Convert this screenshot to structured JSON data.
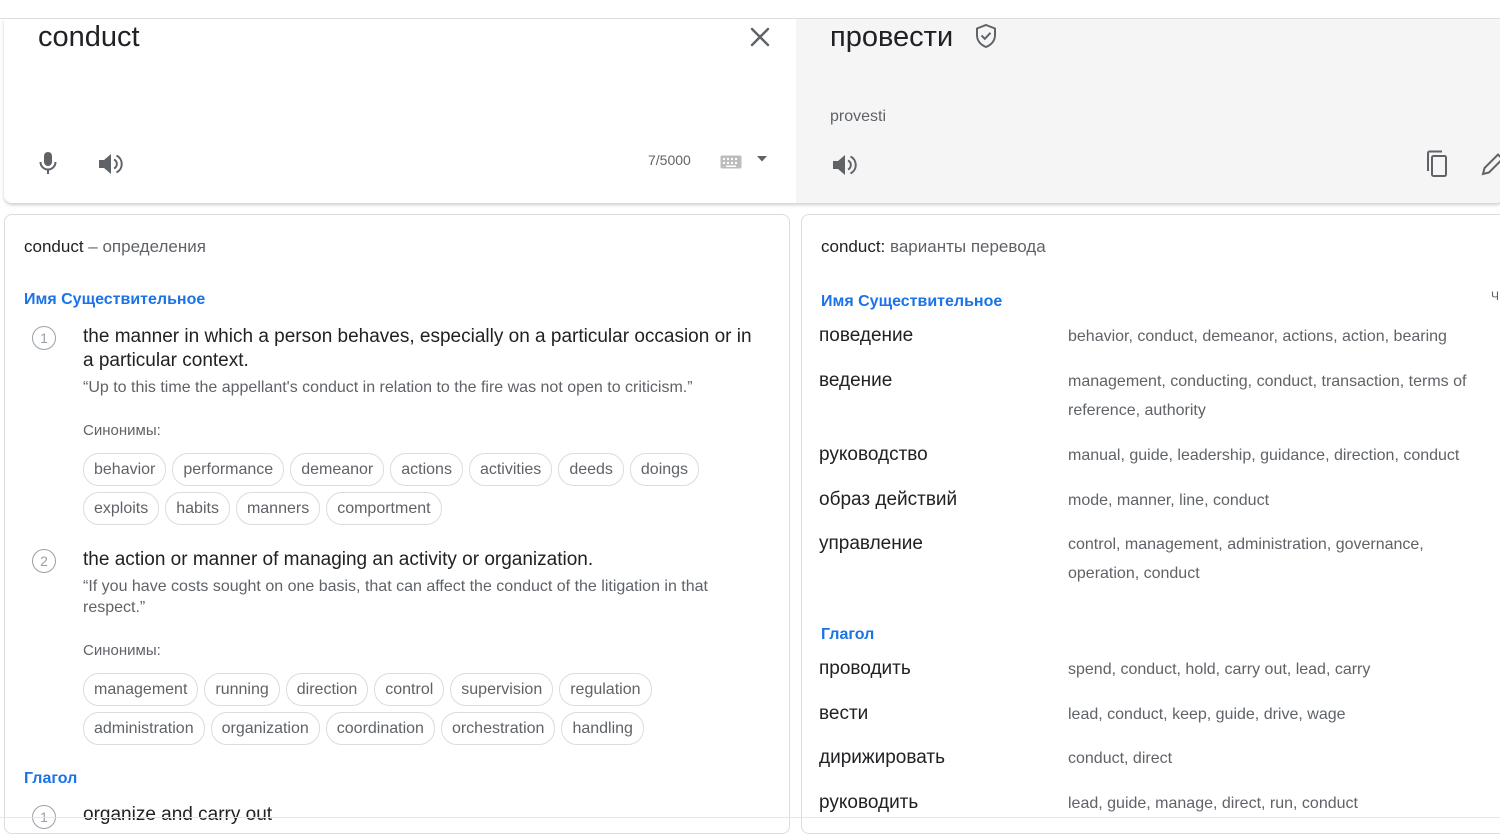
{
  "source": {
    "text": "conduct",
    "char_count": "7/5000"
  },
  "target": {
    "text": "провести",
    "transliteration": "provesti"
  },
  "definitions": {
    "word": "conduct",
    "title_suffix": " – определения",
    "noun_label": "Имя Существительное",
    "verb_label": "Глагол",
    "synonyms_label": "Синонимы:",
    "items": [
      {
        "num": "1",
        "text": "the manner in which a person behaves, especially on a particular occasion or in a particular context.",
        "example": "“Up to this time the appellant's conduct in relation to the fire was not open to criticism.”",
        "synonym_rows": [
          [
            "behavior",
            "performance",
            "demeanor",
            "actions",
            "activities",
            "deeds",
            "doings"
          ],
          [
            "exploits",
            "habits",
            "manners",
            "comportment"
          ]
        ]
      },
      {
        "num": "2",
        "text": "the action or manner of managing an activity or organization.",
        "example": "“If you have costs sought on one basis, that can affect the conduct of the litigation in that respect.”",
        "synonym_rows": [
          [
            "management",
            "running",
            "direction",
            "control",
            "supervision",
            "regulation"
          ],
          [
            "administration",
            "organization",
            "coordination",
            "orchestration",
            "handling"
          ]
        ]
      }
    ],
    "verb_item": {
      "num": "1",
      "text": "organize and carry out"
    }
  },
  "variants": {
    "word": "conduct",
    "title_suffix": " варианты перевода",
    "noun_label": "Имя Существительное",
    "verb_label": "Глагол",
    "freq_mark": "Ч",
    "nouns": [
      {
        "word": "поведение",
        "translations": "behavior, conduct, demeanor, actions, action, bearing"
      },
      {
        "word": "ведение",
        "translations": "management, conducting, conduct, transaction, terms of reference, authority"
      },
      {
        "word": "руководство",
        "translations": "manual, guide, leadership, guidance, direction, conduct"
      },
      {
        "word": "образ действий",
        "translations": "mode, manner, line, conduct"
      },
      {
        "word": "управление",
        "translations": "control, management, administration, governance, operation, conduct"
      }
    ],
    "verbs": [
      {
        "word": "проводить",
        "translations": "spend, conduct, hold, carry out, lead, carry"
      },
      {
        "word": "вести",
        "translations": "lead, conduct, keep, guide, drive, wage"
      },
      {
        "word": "дирижировать",
        "translations": "conduct, direct"
      },
      {
        "word": "руководить",
        "translations": "lead, guide, manage, direct, run, conduct"
      }
    ]
  },
  "icons": [
    "close-icon",
    "mic-icon",
    "speaker-icon",
    "keyboard-icon",
    "dropdown-icon",
    "verified-icon",
    "copy-icon",
    "edit-icon"
  ]
}
